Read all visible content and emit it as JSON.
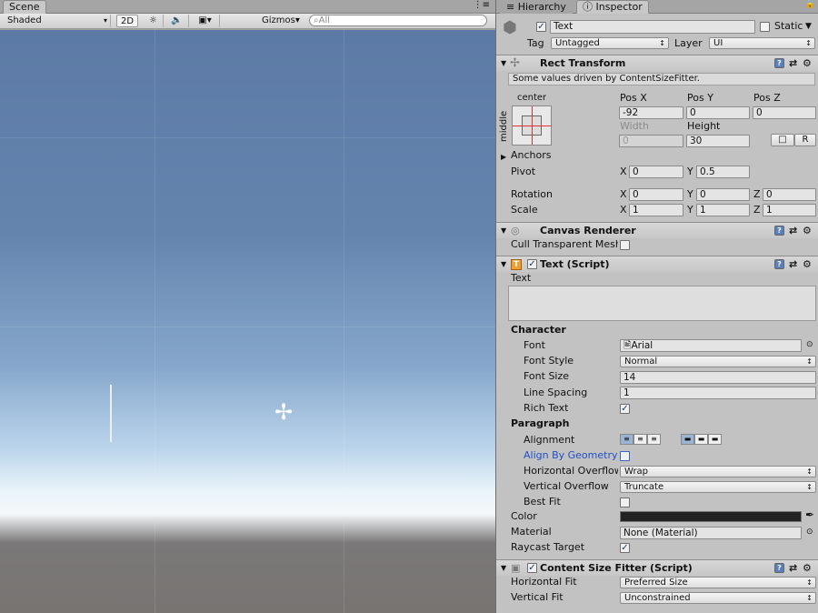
{
  "scene": {
    "tab_label": "Scene",
    "shading": "Shaded",
    "mode_2d": "2D",
    "gizmos": "Gizmos",
    "search_placeholder": "All"
  },
  "hierarchy": {
    "tab_label": "Hierarchy"
  },
  "inspector": {
    "tab_label": "Inspector",
    "object": {
      "name": "Text",
      "static_label": "Static",
      "tag_label": "Tag",
      "tag_value": "Untagged",
      "layer_label": "Layer",
      "layer_value": "UI"
    },
    "rect_transform": {
      "title": "Rect Transform",
      "note": "Some values driven by ContentSizeFitter.",
      "anchor_h": "center",
      "anchor_v": "middle",
      "pos_x_label": "Pos X",
      "pos_y_label": "Pos Y",
      "pos_z_label": "Pos Z",
      "pos_x": "-92",
      "pos_y": "0",
      "pos_z": "0",
      "width_label": "Width",
      "height_label": "Height",
      "width": "0",
      "height": "30",
      "r_label": "R",
      "anchors_label": "Anchors",
      "pivot_label": "Pivot",
      "pivot_x": "0",
      "pivot_y": "0.5",
      "rotation_label": "Rotation",
      "rot_x": "0",
      "rot_y": "0",
      "rot_z": "0",
      "scale_label": "Scale",
      "scale_x": "1",
      "scale_y": "1",
      "scale_z": "1",
      "x": "X",
      "y": "Y",
      "z": "Z"
    },
    "canvas_renderer": {
      "title": "Canvas Renderer",
      "cull_label": "Cull Transparent Mesh"
    },
    "text_script": {
      "title": "Text (Script)",
      "text_label": "Text",
      "character_label": "Character",
      "font_label": "Font",
      "font_value": "Arial",
      "font_style_label": "Font Style",
      "font_style_value": "Normal",
      "font_size_label": "Font Size",
      "font_size_value": "14",
      "line_spacing_label": "Line Spacing",
      "line_spacing_value": "1",
      "rich_text_label": "Rich Text",
      "paragraph_label": "Paragraph",
      "alignment_label": "Alignment",
      "align_geometry_label": "Align By Geometry",
      "h_overflow_label": "Horizontal Overflow",
      "h_overflow_value": "Wrap",
      "v_overflow_label": "Vertical Overflow",
      "v_overflow_value": "Truncate",
      "best_fit_label": "Best Fit",
      "color_label": "Color",
      "color_value": "#222222",
      "material_label": "Material",
      "material_value": "None (Material)",
      "raycast_label": "Raycast Target"
    },
    "content_size_fitter": {
      "title": "Content Size Fitter (Script)",
      "h_fit_label": "Horizontal Fit",
      "h_fit_value": "Preferred Size",
      "v_fit_label": "Vertical Fit",
      "v_fit_value": "Unconstrained"
    }
  }
}
